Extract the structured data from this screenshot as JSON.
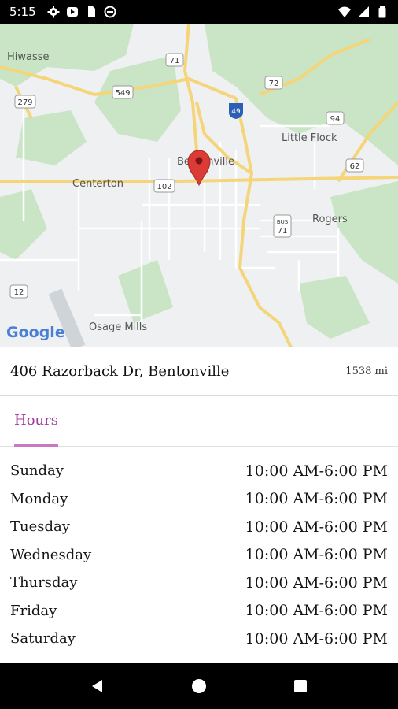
{
  "status_bar": {
    "time": "5:15",
    "left_icons": [
      "settings-icon",
      "play-icon",
      "sim-card-icon",
      "do-not-disturb-icon"
    ],
    "right_icons": [
      "wifi-icon",
      "cell-signal-icon",
      "battery-icon"
    ]
  },
  "map": {
    "attribution": "Google",
    "labels": {
      "hiwasse": "Hiwasse",
      "centerton": "Centerton",
      "bentonville": "Bentonville",
      "little_flock": "Little Flock",
      "rogers": "Rogers",
      "osage_mills": "Osage Mills"
    },
    "route_shields": {
      "r71_top": "71",
      "r549": "549",
      "r279": "279",
      "r72": "72",
      "i49": "49",
      "r94": "94",
      "r62": "62",
      "r102": "102",
      "bus71_label": "BUS",
      "bus71": "71",
      "r12": "12"
    },
    "colors": {
      "road": "#f5d57a",
      "park": "#c9e5c5",
      "background": "#eef0f1",
      "marker": "#db3b36"
    }
  },
  "location": {
    "address": "406 Razorback Dr, Bentonville",
    "distance": "1538 mi"
  },
  "tabs": {
    "hours_label": "Hours",
    "accent_color": "#a0399c"
  },
  "hours": [
    {
      "day": "Sunday",
      "time": "10:00 AM-6:00 PM"
    },
    {
      "day": "Monday",
      "time": "10:00 AM-6:00 PM"
    },
    {
      "day": "Tuesday",
      "time": "10:00 AM-6:00 PM"
    },
    {
      "day": "Wednesday",
      "time": "10:00 AM-6:00 PM"
    },
    {
      "day": "Thursday",
      "time": "10:00 AM-6:00 PM"
    },
    {
      "day": "Friday",
      "time": "10:00 AM-6:00 PM"
    },
    {
      "day": "Saturday",
      "time": "10:00 AM-6:00 PM"
    }
  ],
  "nav_bar": {
    "icons": [
      "back-icon",
      "home-icon",
      "recents-icon"
    ]
  }
}
